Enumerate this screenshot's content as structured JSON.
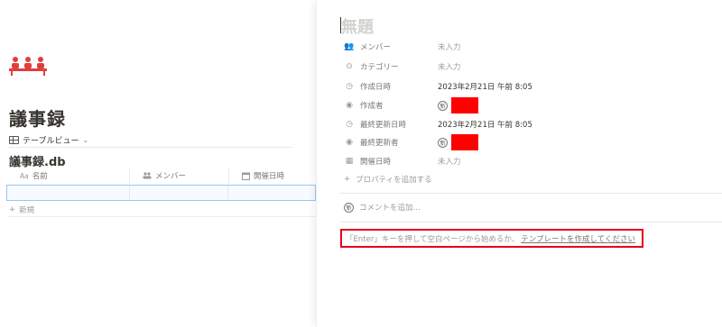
{
  "left": {
    "page_title": "議事録",
    "view_tab_label": "テーブルビュー",
    "database_title": "議事録.db",
    "columns": [
      {
        "icon": "Aa",
        "label": "名前"
      },
      {
        "icon": "people-icon",
        "label": "メンバー"
      },
      {
        "icon": "calendar-icon",
        "label": "開催日時"
      }
    ],
    "new_row_label": "新規",
    "accent_color": "#e03e3e"
  },
  "peek": {
    "title_placeholder": "無題",
    "properties": [
      {
        "icon": "people-icon",
        "name": "メンバー",
        "value": "未入力",
        "empty": true
      },
      {
        "icon": "select-icon",
        "name": "カテゴリー",
        "value": "未入力",
        "empty": true
      },
      {
        "icon": "clock-icon",
        "name": "作成日時",
        "value": "2023年2月21日 午前 8:05",
        "empty": false
      },
      {
        "icon": "person-icon",
        "name": "作成者",
        "value": "",
        "avatar": "新",
        "redacted": true
      },
      {
        "icon": "clock-icon",
        "name": "最終更新日時",
        "value": "2023年2月21日 午前 8:05",
        "empty": false
      },
      {
        "icon": "person-icon",
        "name": "最終更新者",
        "value": "",
        "avatar": "新",
        "redacted": true
      },
      {
        "icon": "calendar-icon",
        "name": "開催日時",
        "value": "未入力",
        "empty": true
      }
    ],
    "add_property_label": "プロパティを追加する",
    "comment_placeholder": "コメントを追加...",
    "comment_avatar": "新",
    "hint_text": "「Enter」キーを押して空白ページから始めるか、",
    "hint_link": "テンプレートを作成してください",
    "highlight_color": "#e6001a"
  }
}
